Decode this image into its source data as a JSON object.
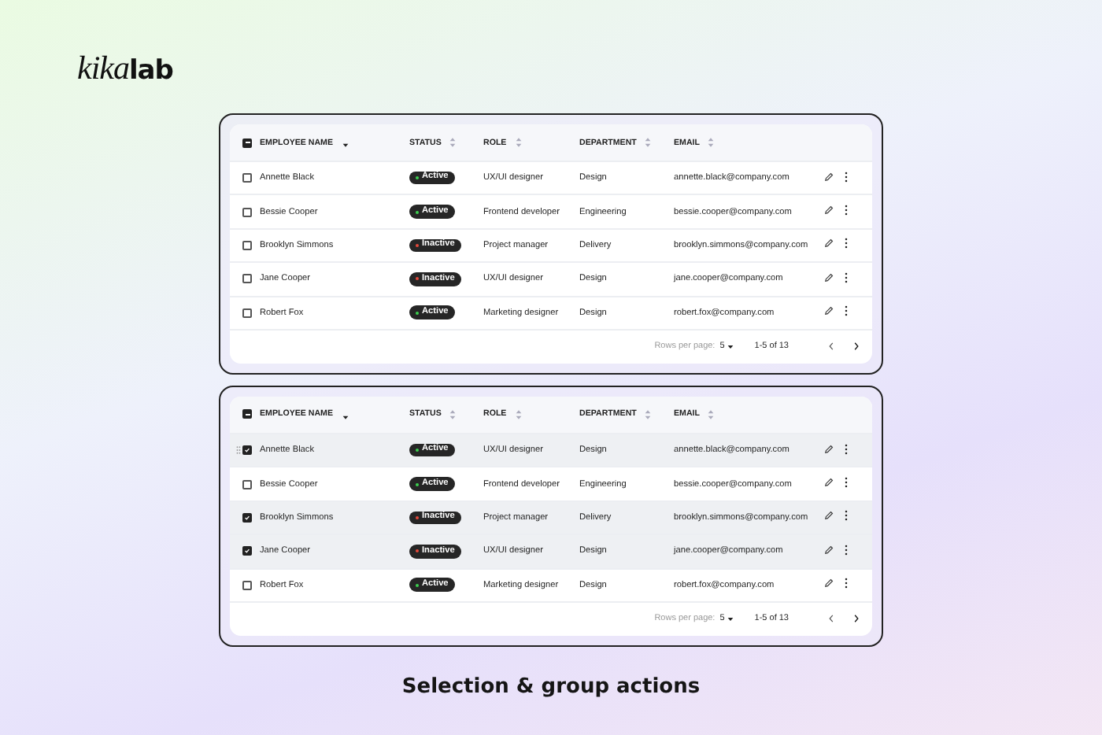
{
  "logo": {
    "script": "kika",
    "bold": "lab"
  },
  "tables": [
    {
      "select_all_indeterminate": true,
      "columns": [
        {
          "label": "EMPLOYEE NAME",
          "sorted": true
        },
        {
          "label": "STATUS",
          "sorted": false
        },
        {
          "label": "ROLE",
          "sorted": false
        },
        {
          "label": "DEPARTMENT",
          "sorted": false
        },
        {
          "label": "EMAIL",
          "sorted": false
        }
      ],
      "rows": [
        {
          "name": "Annette Black",
          "status": "Active",
          "color": "#3ccf4e",
          "role": "UX/UI designer",
          "department": "Design",
          "email": "annette.black@company.com",
          "selected": false,
          "drag_handle": false
        },
        {
          "name": "Bessie Cooper",
          "status": "Active",
          "color": "#3ccf4e",
          "role": "Frontend developer",
          "department": "Engineering",
          "email": "bessie.cooper@company.com",
          "selected": false,
          "drag_handle": false
        },
        {
          "name": "Brooklyn Simmons",
          "status": "Inactive",
          "color": "#e5483a",
          "role": "Project manager",
          "department": "Delivery",
          "email": "brooklyn.simmons@company.com",
          "selected": false,
          "drag_handle": false
        },
        {
          "name": "Jane Cooper",
          "status": "Inactive",
          "color": "#e5483a",
          "role": "UX/UI designer",
          "department": "Design",
          "email": "jane.cooper@company.com",
          "selected": false,
          "drag_handle": false
        },
        {
          "name": "Robert Fox",
          "status": "Active",
          "color": "#3ccf4e",
          "role": "Marketing designer",
          "department": "Design",
          "email": "robert.fox@company.com",
          "selected": false,
          "drag_handle": false
        }
      ],
      "footer": {
        "rows_label": "Rows per page:",
        "rows_value": "5",
        "range": "1-5 of 13"
      }
    },
    {
      "select_all_indeterminate": true,
      "columns": [
        {
          "label": "EMPLOYEE NAME",
          "sorted": true
        },
        {
          "label": "STATUS",
          "sorted": false
        },
        {
          "label": "ROLE",
          "sorted": false
        },
        {
          "label": "DEPARTMENT",
          "sorted": false
        },
        {
          "label": "EMAIL",
          "sorted": false
        }
      ],
      "rows": [
        {
          "name": "Annette Black",
          "status": "Active",
          "color": "#3ccf4e",
          "role": "UX/UI designer",
          "department": "Design",
          "email": "annette.black@company.com",
          "selected": true,
          "drag_handle": true
        },
        {
          "name": "Bessie Cooper",
          "status": "Active",
          "color": "#3ccf4e",
          "role": "Frontend developer",
          "department": "Engineering",
          "email": "bessie.cooper@company.com",
          "selected": false,
          "drag_handle": false
        },
        {
          "name": "Brooklyn Simmons",
          "status": "Inactive",
          "color": "#e5483a",
          "role": "Project manager",
          "department": "Delivery",
          "email": "brooklyn.simmons@company.com",
          "selected": true,
          "drag_handle": false
        },
        {
          "name": "Jane Cooper",
          "status": "Inactive",
          "color": "#e5483a",
          "role": "UX/UI designer",
          "department": "Design",
          "email": "jane.cooper@company.com",
          "selected": true,
          "drag_handle": false
        },
        {
          "name": "Robert Fox",
          "status": "Active",
          "color": "#3ccf4e",
          "role": "Marketing designer",
          "department": "Design",
          "email": "robert.fox@company.com",
          "selected": false,
          "drag_handle": false
        }
      ],
      "footer": {
        "rows_label": "Rows per page:",
        "rows_value": "5",
        "range": "1-5 of 13"
      }
    }
  ],
  "caption": "Selection & group actions"
}
